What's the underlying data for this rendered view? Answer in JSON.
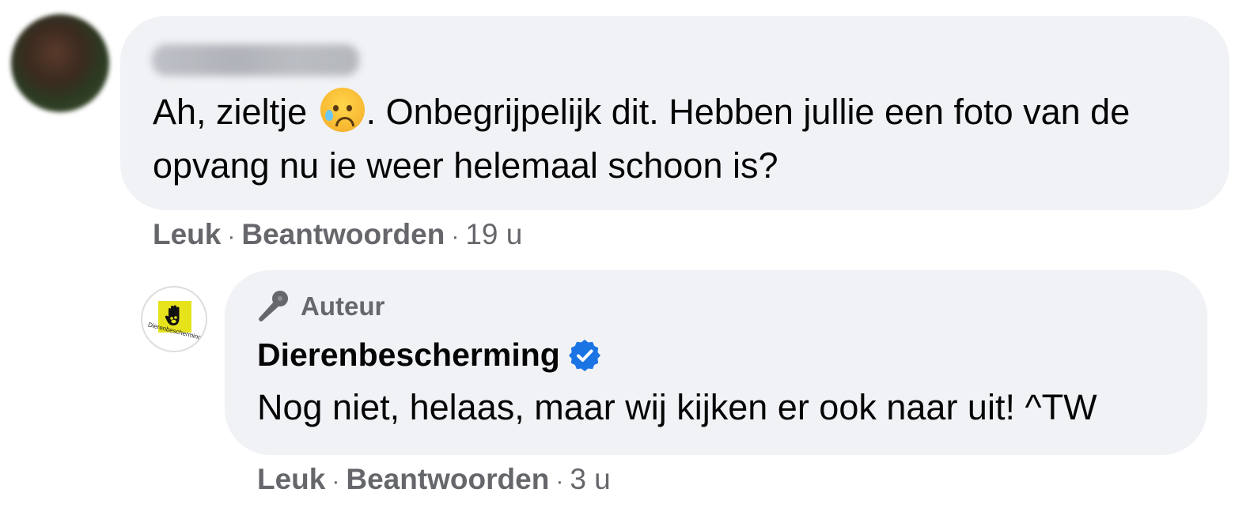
{
  "comment": {
    "author_name": "Mirjanda Kok",
    "text_before_emoji": "Ah, zieltje ",
    "emoji": "sad-but-relieved-face-icon",
    "text_after_emoji": ". Onbegrijpelijk dit. Hebben jullie een foto van de opvang nu ie weer helemaal schoon is?",
    "like_label": "Leuk",
    "reply_label": "Beantwoorden",
    "separator": "·",
    "time": "19 u"
  },
  "reply": {
    "badge_label": "Auteur",
    "author_name": "Dierenbescherming",
    "avatar_logo_text": "Dierenbescherming",
    "text": "Nog niet, helaas, maar wij kijken er ook naar uit! ^TW",
    "like_label": "Leuk",
    "reply_label": "Beantwoorden",
    "separator": "·",
    "time": "3 u"
  },
  "colors": {
    "bubble_bg": "#f0f2f5",
    "meta_text": "#65676b",
    "verified_blue": "#1b74e4",
    "logo_yellow": "#e6e31c"
  }
}
